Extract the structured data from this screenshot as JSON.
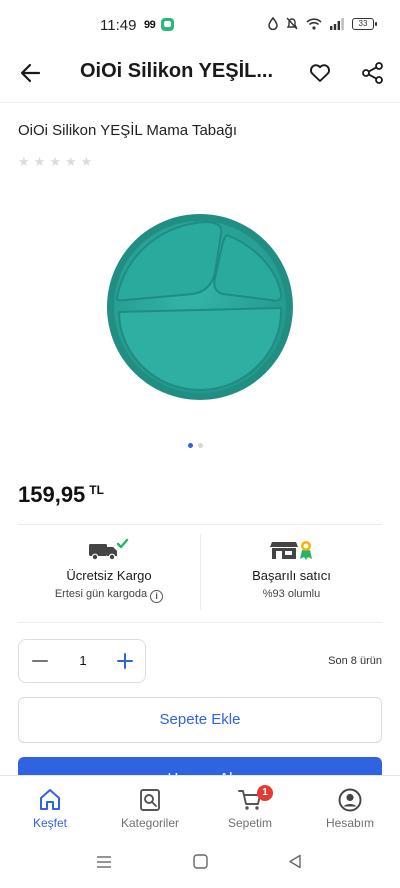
{
  "status_bar": {
    "time": "11:49",
    "app_badge": "99",
    "battery": "33"
  },
  "header": {
    "title": "OiOi Silikon YEŞİL..."
  },
  "product": {
    "name": "OiOi Silikon YEŞİL Mama Tabağı",
    "rating_stars": 5,
    "image_color": "#2ba598",
    "image_pages": 2,
    "active_page": 1
  },
  "price": {
    "amount": "159,95",
    "currency": "TL"
  },
  "features": [
    {
      "title": "Ücretsiz Kargo",
      "subtitle": "Ertesi gün kargoda",
      "icon": "delivery-truck-icon"
    },
    {
      "title": "Başarılı satıcı",
      "subtitle": "%93 olumlu",
      "icon": "store-award-icon"
    }
  ],
  "quantity": {
    "value": "1",
    "stock_text": "Son 8 ürün"
  },
  "actions": {
    "add_to_cart": "Sepete Ekle",
    "buy_now": "Hemen Al"
  },
  "bottom_nav": [
    {
      "label": "Keşfet",
      "icon": "home-icon",
      "active": true
    },
    {
      "label": "Kategoriler",
      "icon": "category-search-icon",
      "active": false
    },
    {
      "label": "Sepetim",
      "icon": "cart-icon",
      "active": false,
      "badge": "1"
    },
    {
      "label": "Hesabım",
      "icon": "account-icon",
      "active": false
    }
  ],
  "colors": {
    "accent": "#2f63e0",
    "badge": "#e53935",
    "success": "#27b36b"
  }
}
